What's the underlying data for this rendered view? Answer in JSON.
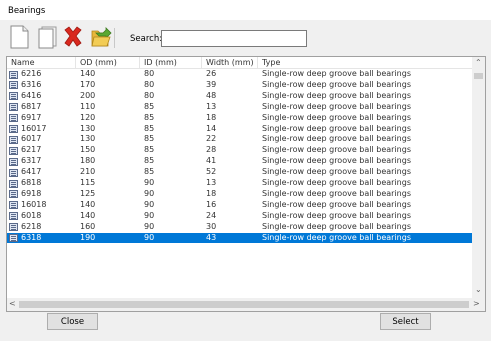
{
  "window": {
    "title": "Bearings"
  },
  "toolbar": {
    "icons": [
      "new-document-icon",
      "copy-icon",
      "delete-icon",
      "open-folder-icon"
    ],
    "search_label": "Search:",
    "search_value": ""
  },
  "table": {
    "columns": [
      "Name",
      "OD (mm)",
      "ID (mm)",
      "Width (mm)",
      "Type"
    ],
    "rows": [
      [
        "6216",
        "140",
        "80",
        "26",
        "Single-row deep groove ball bearings"
      ],
      [
        "6316",
        "170",
        "80",
        "39",
        "Single-row deep groove ball bearings"
      ],
      [
        "6416",
        "200",
        "80",
        "48",
        "Single-row deep groove ball bearings"
      ],
      [
        "6817",
        "110",
        "85",
        "13",
        "Single-row deep groove ball bearings"
      ],
      [
        "6917",
        "120",
        "85",
        "18",
        "Single-row deep groove ball bearings"
      ],
      [
        "16017",
        "130",
        "85",
        "14",
        "Single-row deep groove ball bearings"
      ],
      [
        "6017",
        "130",
        "85",
        "22",
        "Single-row deep groove ball bearings"
      ],
      [
        "6217",
        "150",
        "85",
        "28",
        "Single-row deep groove ball bearings"
      ],
      [
        "6317",
        "180",
        "85",
        "41",
        "Single-row deep groove ball bearings"
      ],
      [
        "6417",
        "210",
        "85",
        "52",
        "Single-row deep groove ball bearings"
      ],
      [
        "6818",
        "115",
        "90",
        "13",
        "Single-row deep groove ball bearings"
      ],
      [
        "6918",
        "125",
        "90",
        "18",
        "Single-row deep groove ball bearings"
      ],
      [
        "16018",
        "140",
        "90",
        "16",
        "Single-row deep groove ball bearings"
      ],
      [
        "6018",
        "140",
        "90",
        "24",
        "Single-row deep groove ball bearings"
      ],
      [
        "6218",
        "160",
        "90",
        "30",
        "Single-row deep groove ball bearings"
      ],
      [
        "6318",
        "190",
        "90",
        "43",
        "Single-row deep groove ball bearings"
      ]
    ],
    "selected_name": "6318"
  },
  "buttons": {
    "close_label": "Close",
    "select_label": "Select"
  },
  "colors": {
    "selection": "#0078d7",
    "delete_red": "#d9281e"
  }
}
